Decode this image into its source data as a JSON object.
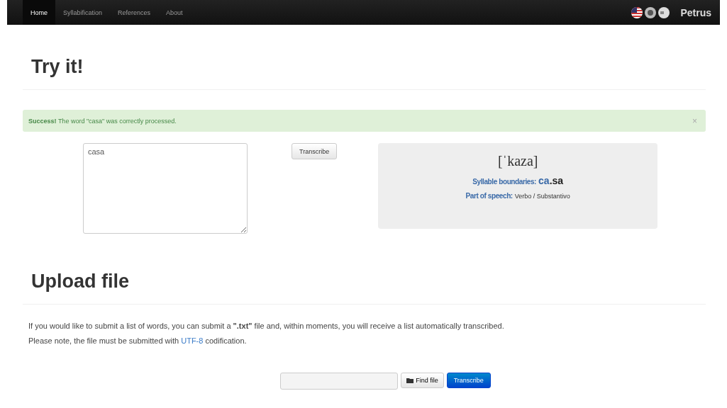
{
  "navbar": {
    "items": [
      {
        "label": "Home",
        "selected": true
      },
      {
        "label": "Syllabification",
        "selected": false
      },
      {
        "label": "References",
        "selected": false
      },
      {
        "label": "About",
        "selected": false
      }
    ],
    "brand": "Petrus"
  },
  "try_it": {
    "heading": "Try it!",
    "alert": {
      "strong": "Success!",
      "message": "The word \"casa\" was correctly processed.",
      "close": "×"
    },
    "word_field": {
      "value": "casa"
    },
    "transcribe_button": "Transcribe",
    "result": {
      "transcription": "[ˈkaza]",
      "syllable_label": "Syllable boundaries:",
      "syllables": [
        {
          "text": "ca",
          "highlighted": true
        },
        {
          "text": ".sa",
          "highlighted": false
        }
      ],
      "pos_label": "Part of speech:",
      "pos_value": "Verbo / Substantivo"
    }
  },
  "upload": {
    "heading": "Upload file",
    "paragraph": [
      "If you would like to submit a list of words, you can submit a **\".txt\"** file and, within moments, you will receive a list automatically transcribed.",
      "Please note, the file must be submitted with ",
      "UTF-8",
      " codification."
    ],
    "find_button": "Find file",
    "transcribe_button": "Transcribe"
  }
}
